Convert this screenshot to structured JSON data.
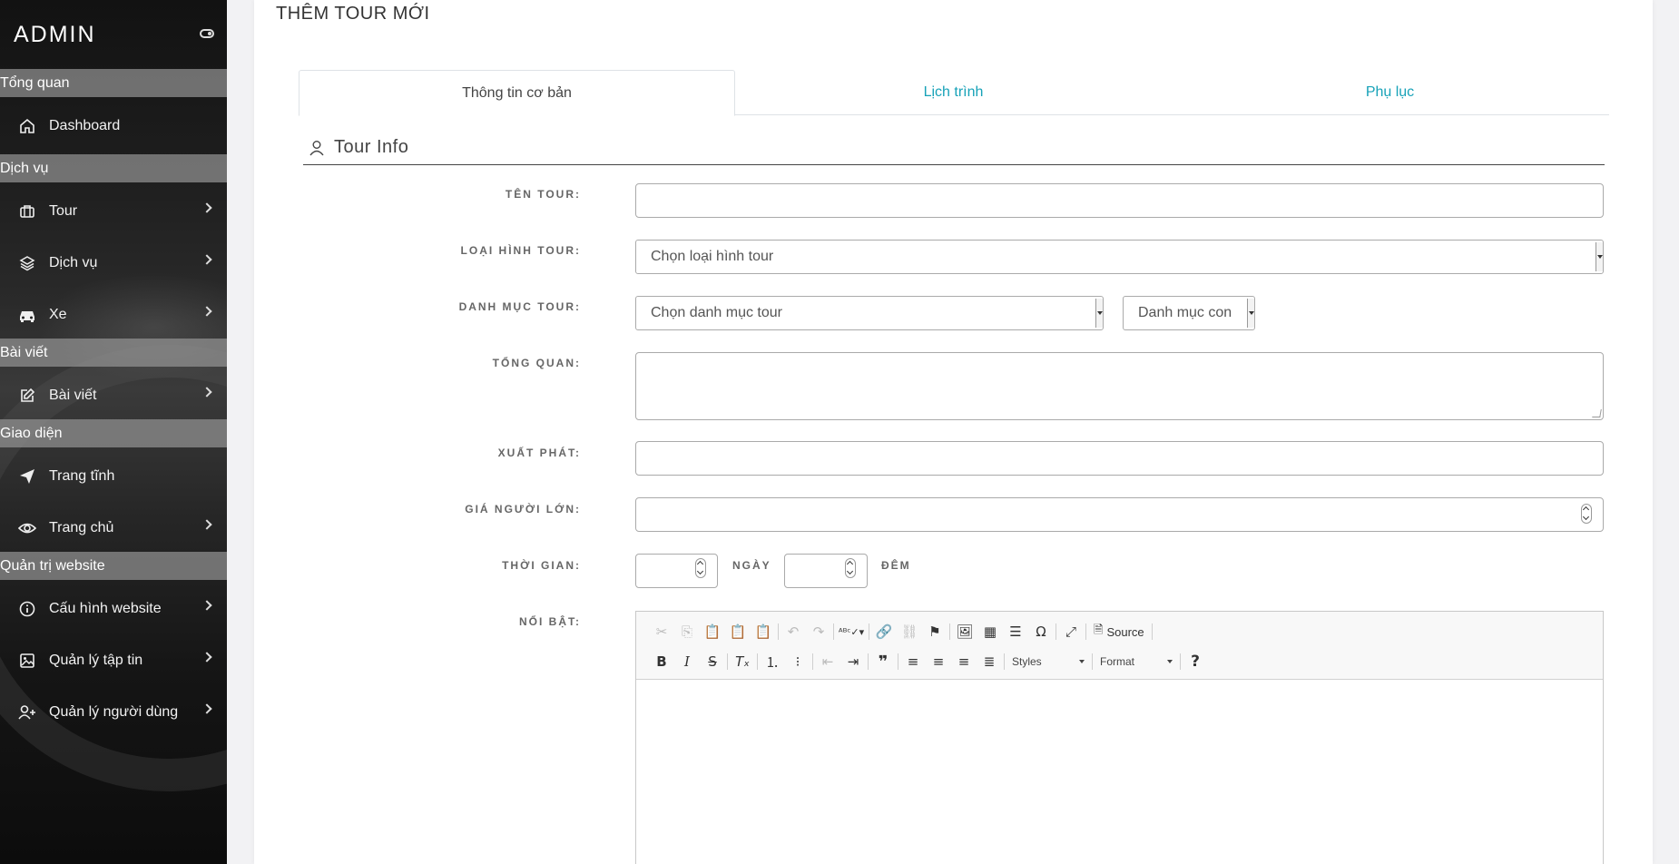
{
  "sidebar": {
    "brand": "ADMIN",
    "sections": {
      "overview": "Tổng quan",
      "services": "Dịch vụ",
      "posts": "Bài viết",
      "appearance": "Giao diện",
      "website_admin": "Quản trị website"
    },
    "items": {
      "dashboard": "Dashboard",
      "tour": "Tour",
      "service": "Dịch vụ",
      "car": "Xe",
      "post": "Bài viết",
      "static_page": "Trang tĩnh",
      "home": "Trang chủ",
      "site_config": "Cấu hình website",
      "files": "Quản lý tập tin",
      "users": "Quản lý người dùng"
    }
  },
  "main": {
    "title": "THÊM TOUR MỚI",
    "tabs": [
      "Thông tin cơ bản",
      "Lịch trình",
      "Phụ lục"
    ],
    "section_title": "Tour Info",
    "labels": {
      "name": "TÊN TOUR:",
      "type": "LOẠI HÌNH TOUR:",
      "category": "DANH MỤC TOUR:",
      "overview": "TỔNG QUAN:",
      "departure": "XUẤT PHÁT:",
      "adult_price": "GIÁ NGƯỜI LỚN:",
      "duration": "THỜI GIAN:",
      "days": "NGÀY",
      "nights": "ĐÊM",
      "highlights": "NỔI BẬT:"
    },
    "selects": {
      "type_placeholder": "Chọn loại hình tour",
      "category_placeholder": "Chọn danh mục tour",
      "subcategory_placeholder": "Danh mục con"
    },
    "editor": {
      "source_label": "Source",
      "styles_label": "Styles",
      "format_label": "Format",
      "help_label": "?"
    }
  }
}
